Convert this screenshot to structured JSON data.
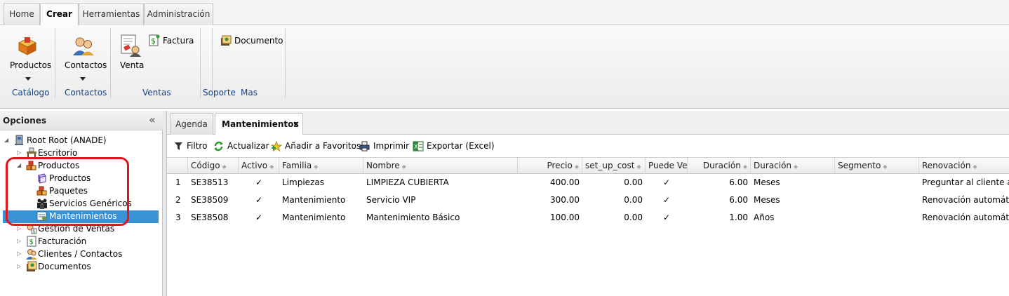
{
  "ribbon": {
    "tabs": [
      "Home",
      "Crear",
      "Herramientas",
      "Administración"
    ],
    "buttons": {
      "productos": "Productos",
      "contactos": "Contactos",
      "venta": "Venta",
      "factura": "Factura",
      "documento": "Documento"
    },
    "groups": {
      "catalogo": "Catálogo",
      "contactos": "Contactos",
      "ventas": "Ventas",
      "soporte": "Soporte",
      "mas": "Mas"
    }
  },
  "left_panel": {
    "title": "Opciones",
    "collapse_glyph": "«",
    "tree": {
      "root": "Root Root (ANADE)",
      "escritorio": "Escritorio",
      "productos": "Productos",
      "productos_children": [
        "Productos",
        "Paquetes",
        "Servicios Genéricos",
        "Mantenimientos"
      ],
      "gestion_ventas": "Gestion de Ventas",
      "facturacion": "Facturación",
      "clientes": "Clientes / Contactos",
      "documentos": "Documentos"
    }
  },
  "main": {
    "tabs": [
      "Agenda",
      "Mantenimientos"
    ],
    "close_glyph": "×",
    "toolbar": {
      "filtro": "Filtro",
      "actualizar": "Actualizar",
      "favoritos": "Añadir a Favoritos",
      "imprimir": "Imprimir",
      "exportar": "Exportar (Excel)"
    },
    "grid": {
      "columns": [
        "Código",
        "Activo",
        "Familia",
        "Nombre",
        "Precio",
        "set_up_cost",
        "Puede Ven",
        "Duración",
        "Duración",
        "Segmento",
        "Renovación"
      ],
      "rows": [
        {
          "num": "1",
          "codigo": "SE38513",
          "activo": "✓",
          "familia": "Limpiezas",
          "nombre": "LIMPIEZA CUBIERTA",
          "precio": "400.00",
          "setup": "0.00",
          "puede": "✓",
          "duracion": "6.00",
          "unidad": "Meses",
          "segmento": "",
          "renovacion": "Preguntar al cliente a"
        },
        {
          "num": "2",
          "codigo": "SE38509",
          "activo": "✓",
          "familia": "Mantenimiento",
          "nombre": "Servicio VIP",
          "precio": "300.00",
          "setup": "0.00",
          "puede": "✓",
          "duracion": "6.00",
          "unidad": "Meses",
          "segmento": "",
          "renovacion": "Renovación automátic"
        },
        {
          "num": "3",
          "codigo": "SE38508",
          "activo": "✓",
          "familia": "Mantenimiento",
          "nombre": "Mantenimiento Básico",
          "precio": "100.00",
          "setup": "0.00",
          "puede": "✓",
          "duracion": "1.00",
          "unidad": "Años",
          "segmento": "",
          "renovacion": "Renovación automátic"
        }
      ]
    }
  },
  "colors": {
    "selection": "#3892d3",
    "highlight_box": "#e3141c",
    "group_label": "#15428b"
  }
}
